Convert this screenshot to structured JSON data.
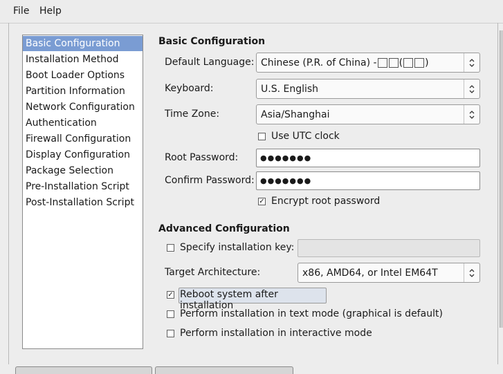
{
  "menubar": {
    "file": "File",
    "help": "Help"
  },
  "sidebar": {
    "items": [
      {
        "label": "Basic Configuration",
        "selected": true
      },
      {
        "label": "Installation Method"
      },
      {
        "label": "Boot Loader Options"
      },
      {
        "label": "Partition Information"
      },
      {
        "label": "Network Configuration"
      },
      {
        "label": "Authentication"
      },
      {
        "label": "Firewall Configuration"
      },
      {
        "label": "Display Configuration"
      },
      {
        "label": "Package Selection"
      },
      {
        "label": "Pre-Installation Script"
      },
      {
        "label": "Post-Installation Script"
      }
    ]
  },
  "basic": {
    "heading": "Basic Configuration",
    "language_label": "Default Language:",
    "language_value_prefix": "Chinese (P.R. of China) - ",
    "keyboard_label": "Keyboard:",
    "keyboard_value": "U.S. English",
    "timezone_label": "Time Zone:",
    "timezone_value": "Asia/Shanghai",
    "utc_label": "Use UTC clock",
    "utc_checked": false,
    "root_password_label": "Root Password:",
    "root_password_value": "●●●●●●●",
    "confirm_password_label": "Confirm Password:",
    "confirm_password_value": "●●●●●●●",
    "encrypt_label": "Encrypt root password",
    "encrypt_checked": true
  },
  "advanced": {
    "heading": "Advanced Configuration",
    "install_key_label": "Specify installation key:",
    "install_key_checked": false,
    "install_key_value": "",
    "arch_label": "Target Architecture:",
    "arch_value": "x86, AMD64, or Intel EM64T",
    "reboot_label": "Reboot system after installation",
    "reboot_checked": true,
    "text_mode_label": "Perform installation in text mode (graphical is default)",
    "text_mode_checked": false,
    "interactive_label": "Perform installation in interactive mode",
    "interactive_checked": false
  },
  "colors": {
    "selection": "#7a9cd3",
    "background": "#ededed"
  }
}
